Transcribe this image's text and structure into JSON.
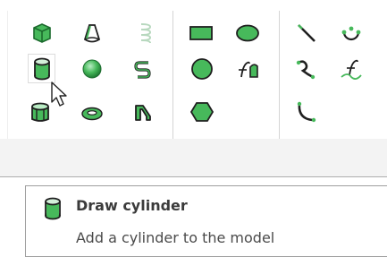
{
  "tooltip": {
    "title": "Draw cylinder",
    "description": "Add a cylinder to the model"
  },
  "ribbon": {
    "hovered_tool": "draw-cylinder",
    "icon_colors": {
      "green_fill": "#46b85a",
      "green_dark": "#1b6a2d",
      "outline": "#1f1f1f",
      "disabled": "#b7d8be"
    }
  }
}
